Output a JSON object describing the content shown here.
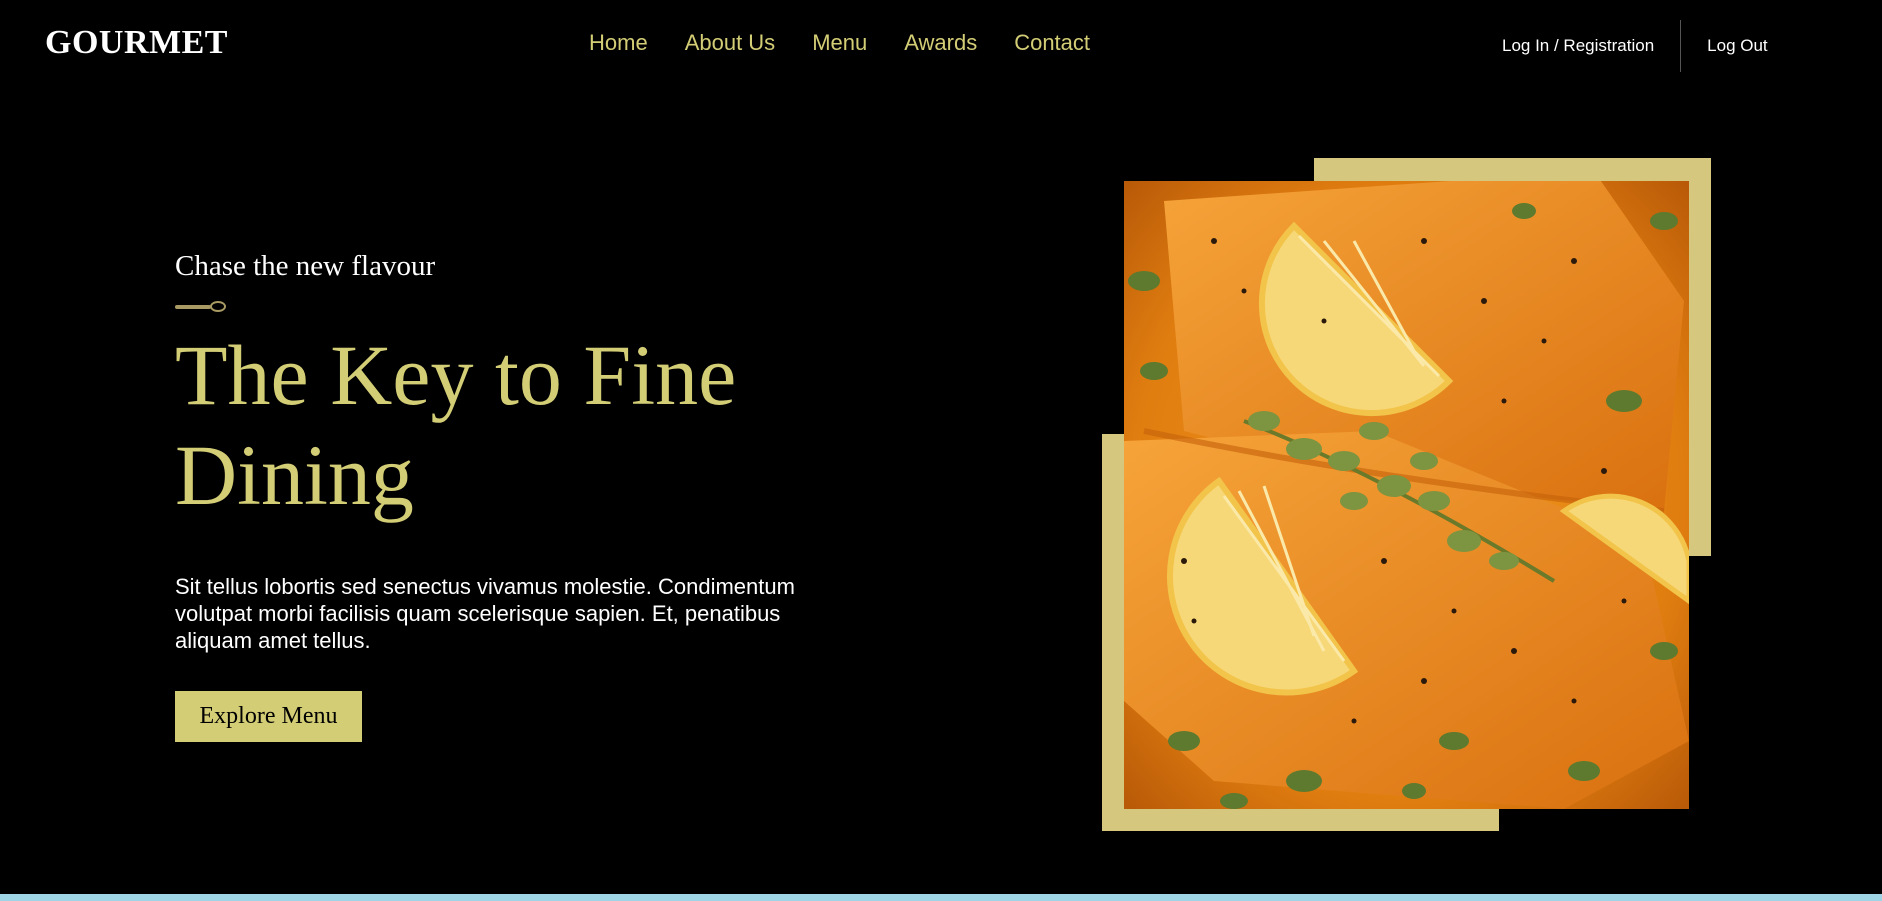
{
  "header": {
    "logo": "GOURMET",
    "nav": [
      {
        "label": "Home"
      },
      {
        "label": "About Us"
      },
      {
        "label": "Menu"
      },
      {
        "label": "Awards"
      },
      {
        "label": "Contact"
      }
    ],
    "login_label": "Log In / Registration",
    "logout_label": "Log Out"
  },
  "hero": {
    "tagline": "Chase the new flavour",
    "headline": "The Key to Fine Dining",
    "description": "Sit tellus lobortis sed senectus vivamus molestie. Condimentum volutpat morbi facilisis quam scelerisque sapien. Et, penatibus aliquam amet tellus.",
    "cta_label": "Explore Menu",
    "image_icon": "salmon-dish-photo"
  },
  "colors": {
    "background": "#000000",
    "accent": "#d3cd76",
    "frame": "#d5c87e",
    "text": "#ffffff"
  }
}
